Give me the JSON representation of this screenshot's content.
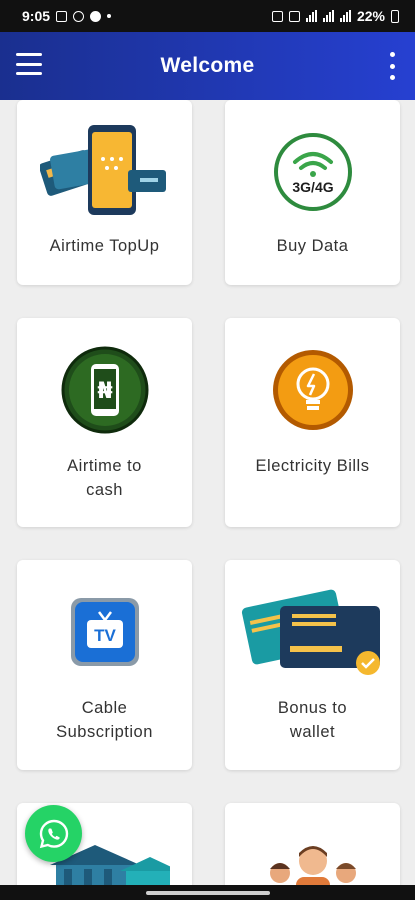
{
  "status": {
    "time": "9:05",
    "battery": "22%"
  },
  "header": {
    "title": "Welcome",
    "menu_icon": "hamburger-menu-icon",
    "more_icon": "more-vertical-icon"
  },
  "services": [
    {
      "label": "Airtime TopUp",
      "icon": "phone-card-icon"
    },
    {
      "label": "Buy Data",
      "icon": "3g-4g-wifi-icon"
    },
    {
      "label": "Airtime to cash",
      "icon": "naira-phone-icon"
    },
    {
      "label": "Electricity Bills",
      "icon": "lightbulb-icon"
    },
    {
      "label": "Cable Subscription",
      "icon": "tv-icon"
    },
    {
      "label": "Bonus to wallet",
      "icon": "credit-cards-icon"
    },
    {
      "label": "",
      "icon": "bank-building-icon"
    },
    {
      "label": "",
      "icon": "people-group-icon"
    }
  ],
  "badges": {
    "data_icon_text": "3G/4G",
    "naira_symbol": "₦",
    "tv_text": "TV"
  },
  "fab": {
    "icon": "whatsapp-icon"
  },
  "colors": {
    "app_bar_start": "#1a2f8f",
    "app_bar_end": "#2640d1",
    "whatsapp": "#25d366"
  }
}
